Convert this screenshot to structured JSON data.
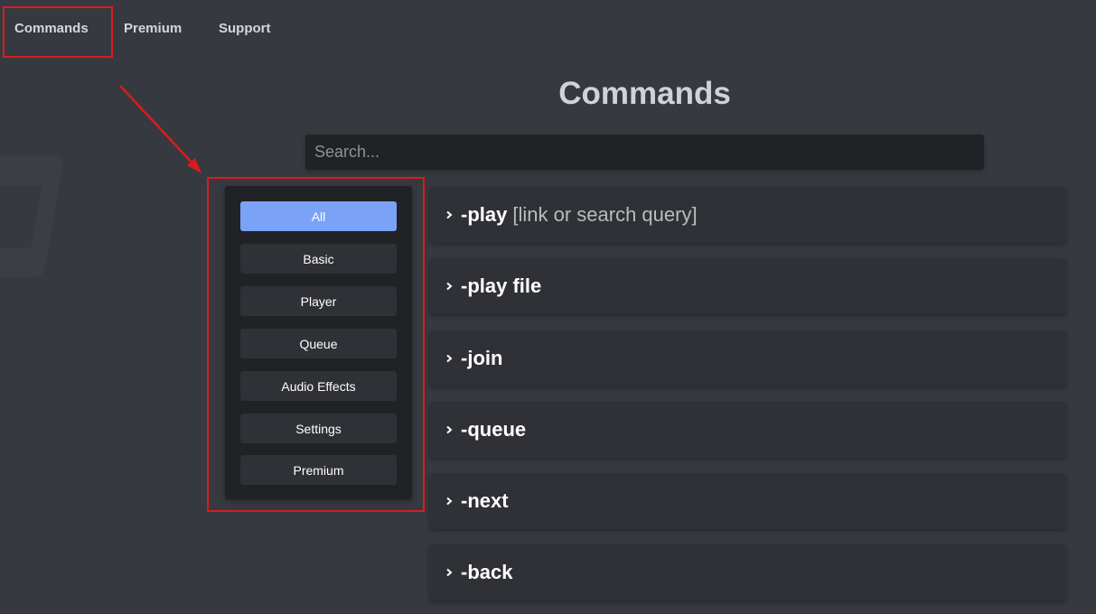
{
  "nav": {
    "items": [
      {
        "label": "Commands"
      },
      {
        "label": "Premium"
      },
      {
        "label": "Support"
      }
    ]
  },
  "page": {
    "title": "Commands"
  },
  "search": {
    "placeholder": "Search..."
  },
  "categories": [
    {
      "label": "All",
      "active": true
    },
    {
      "label": "Basic"
    },
    {
      "label": "Player"
    },
    {
      "label": "Queue"
    },
    {
      "label": "Audio Effects"
    },
    {
      "label": "Settings"
    },
    {
      "label": "Premium"
    }
  ],
  "commands": [
    {
      "name": "-play",
      "args": "[link or search query]"
    },
    {
      "name": "-play file",
      "args": ""
    },
    {
      "name": "-join",
      "args": ""
    },
    {
      "name": "-queue",
      "args": ""
    },
    {
      "name": "-next",
      "args": ""
    },
    {
      "name": "-back",
      "args": ""
    }
  ],
  "colors": {
    "background": "#36393f",
    "panel": "#202225",
    "card": "#2f3136",
    "accent": "#7aa2f7",
    "annotation": "#d91c1c"
  },
  "icons": {
    "chevron": "chevron-right-icon"
  }
}
